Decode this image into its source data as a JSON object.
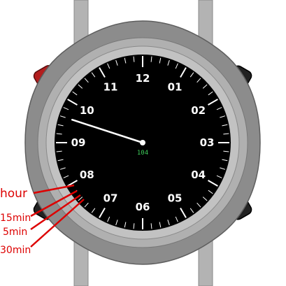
{
  "watch": {
    "hour_labels": [
      "12",
      "01",
      "02",
      "03",
      "04",
      "05",
      "06",
      "07",
      "08",
      "09",
      "10",
      "11"
    ],
    "center_value": "104",
    "hand_reading_hours": 9.6,
    "colors": {
      "bezel_outer": "#8c8c8c",
      "bezel_inner": "#a8a8a8",
      "dial": "#000000",
      "tick": "#ffffff",
      "hand": "#ffffff",
      "readout": "#3ecb5a",
      "button_red": "#b31e1e",
      "button_dark": "#222222",
      "annotation": "#dd0000"
    },
    "buttons": [
      {
        "name": "top-left-button",
        "color": "red"
      },
      {
        "name": "top-right-button",
        "color": "dark"
      },
      {
        "name": "bottom-left-button",
        "color": "dark"
      },
      {
        "name": "bottom-right-button",
        "color": "dark"
      }
    ]
  },
  "annotations": [
    {
      "label": "hour"
    },
    {
      "label": "15min"
    },
    {
      "label": "5min"
    },
    {
      "label": "30min"
    }
  ]
}
